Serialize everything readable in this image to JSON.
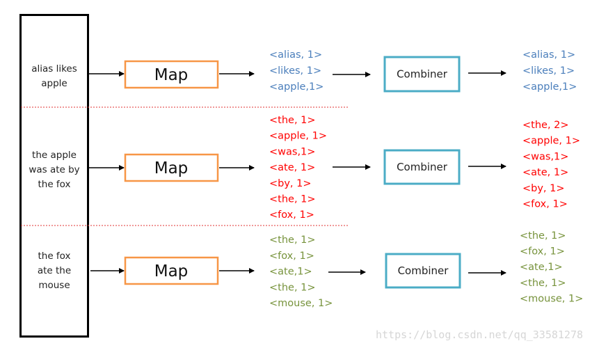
{
  "colors": {
    "row1": "#4a7ebb",
    "row2": "#ff0000",
    "row3": "#77933c",
    "map_border": "#f79646",
    "combiner_border": "#4bacc6",
    "divider": "#e03030"
  },
  "rows": [
    {
      "input": [
        "alias likes",
        "apple"
      ],
      "map_label": "Map",
      "map_output": [
        "<alias, 1>",
        "<likes, 1>",
        "<apple,1>"
      ],
      "combiner_label": "Combiner",
      "combiner_output": [
        "<alias, 1>",
        "<likes, 1>",
        "<apple,1>"
      ]
    },
    {
      "input": [
        "the apple",
        "was ate by",
        "the fox"
      ],
      "map_label": "Map",
      "map_output": [
        "<the, 1>",
        "<apple, 1>",
        "<was,1>",
        "<ate, 1>",
        "<by, 1>",
        "<the, 1>",
        "<fox, 1>"
      ],
      "combiner_label": "Combiner",
      "combiner_output": [
        "<the, 2>",
        "<apple, 1>",
        "<was,1>",
        "<ate, 1>",
        "<by, 1>",
        "<fox, 1>"
      ]
    },
    {
      "input": [
        "the fox",
        "ate the",
        "mouse"
      ],
      "map_label": "Map",
      "map_output": [
        "<the, 1>",
        "<fox, 1>",
        "<ate,1>",
        "<the, 1>",
        "<mouse, 1>"
      ],
      "combiner_label": "Combiner",
      "combiner_output": [
        "<the, 1>",
        "<fox, 1>",
        "<ate,1>",
        "<the, 1>",
        "<mouse, 1>"
      ]
    }
  ],
  "watermark": "https://blog.csdn.net/qq_33581278"
}
